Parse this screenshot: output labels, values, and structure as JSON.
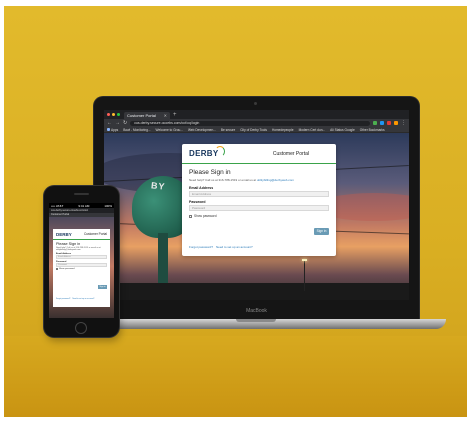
{
  "colors": {
    "background": "#d9ae22",
    "portal_accent_green": "#3aa34a",
    "portal_accent_orange": "#f2a41e",
    "logo_navy": "#17365d",
    "button_blue": "#6a9bb5",
    "link_blue": "#2a7ab8"
  },
  "laptop": {
    "brand": "MacBook",
    "browser": {
      "tab_title": "Customer Portal",
      "url": "cus.derby.secure.ocoebs.com/oct/oq/login",
      "bookmarks": [
        "Apps",
        "Bowl - Monitoring...",
        "Welcome to Grou...",
        "Web Developmen...",
        "Be secure",
        "City of Derby Tools",
        "Homedepeople",
        "Modern Cert dun...",
        "Ali Status Google",
        "Other Bookmarks"
      ]
    },
    "billboard_text": "BY",
    "portal": {
      "logo": "DERBY",
      "title": "Customer Portal",
      "heading": "Please Sign in",
      "help_text": "Need help? Call us at 316-788-1519 or email us at",
      "help_email": "utilitybilling@derbyweb.com",
      "email_label": "Email Address",
      "email_placeholder": "Email Address",
      "password_label": "Password",
      "password_placeholder": "Password",
      "show_password_label": "Show password",
      "signin_button": "Sign in",
      "forgot_link": "Forgot password?",
      "signup_link": "Need to set up an account?"
    }
  },
  "phone": {
    "status_left": "•••• AT&T",
    "status_time": "9:41 AM",
    "status_right": "100%",
    "url": "cus.derby.secure.ocoebs.com/oct",
    "tab_title": "Customer Portal",
    "portal": {
      "logo": "DERBY",
      "title": "Customer Portal",
      "heading": "Please Sign in",
      "help_text": "Need help? Call us at 316-788-1519 or email us at utilitybilling@derbyweb.com",
      "email_label": "Email Address",
      "email_placeholder": "Email Address",
      "password_label": "Password",
      "password_placeholder": "Password",
      "show_password_label": "Show password",
      "signin_button": "Sign in",
      "forgot_link": "Forgot password?",
      "signup_link": "Need to set up an account?"
    }
  }
}
